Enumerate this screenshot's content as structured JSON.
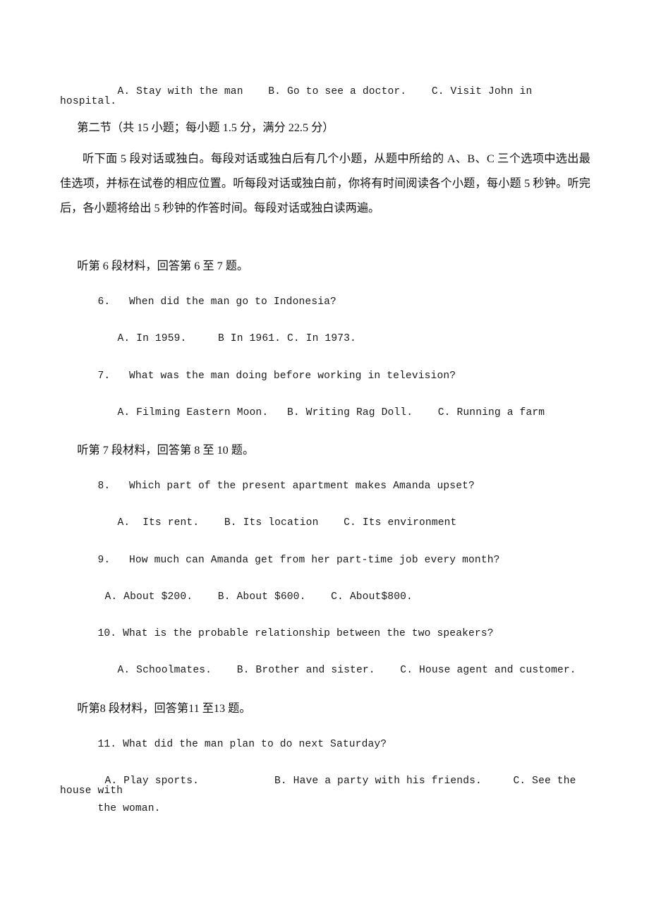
{
  "document": {
    "type": "exam-paper",
    "language": "zh-CN + en",
    "background_color": "#ffffff",
    "text_color": "#000000"
  },
  "lines": {
    "q5_options": "A. Stay with the man    B. Go to see a doctor.    C. Visit John in hospital.",
    "section_heading": "第二节（共 15 小题；每小题 1.5 分，满分 22.5 分）",
    "instructions": "听下面 5 段对话或独白。每段对话或独白后有几个小题，从题中所给的 A、B、C 三个选项中选出最佳选项，并标在试卷的相应位置。听每段对话或独白前，你将有时间阅读各个小题，每小题 5 秒钟。听完后，各小题将给出 5 秒钟的作答时间。每段对话或独白读两遍。",
    "material_6": "听第 6 段材料，回答第 6 至 7 题。",
    "q6_stem": "6.   When did the man go to Indonesia?",
    "q6_options": "A. In 1959.     B In 1961. C. In 1973.",
    "q7_stem": "7.   What was the man doing before working in television?",
    "q7_options": "A. Filming Eastern Moon.   B. Writing Rag Doll.    C. Running a farm",
    "material_7": "听第 7 段材料，回答第 8 至 10 题。",
    "q8_stem": "8.   Which part of the present apartment makes Amanda upset?",
    "q8_options": "A.  Its rent.    B. Its location    C. Its environment",
    "q9_stem": "9.   How much can Amanda get from her part-time job every month?",
    "q9_options": "A. About $200.    B. About $600.    C. About$800.",
    "q10_stem": "10. What is the probable relationship between the two speakers?",
    "q10_options": "A. Schoolmates.    B. Brother and sister.    C. House agent and customer.",
    "material_8": "听第8 段材料，回答第11 至13 题。",
    "q11_stem": "11. What did the man plan to do next Saturday?",
    "q11_options": "A. Play sports.            B. Have a party with his friends.     C. See the house with",
    "q11_options_cont": "the woman."
  }
}
